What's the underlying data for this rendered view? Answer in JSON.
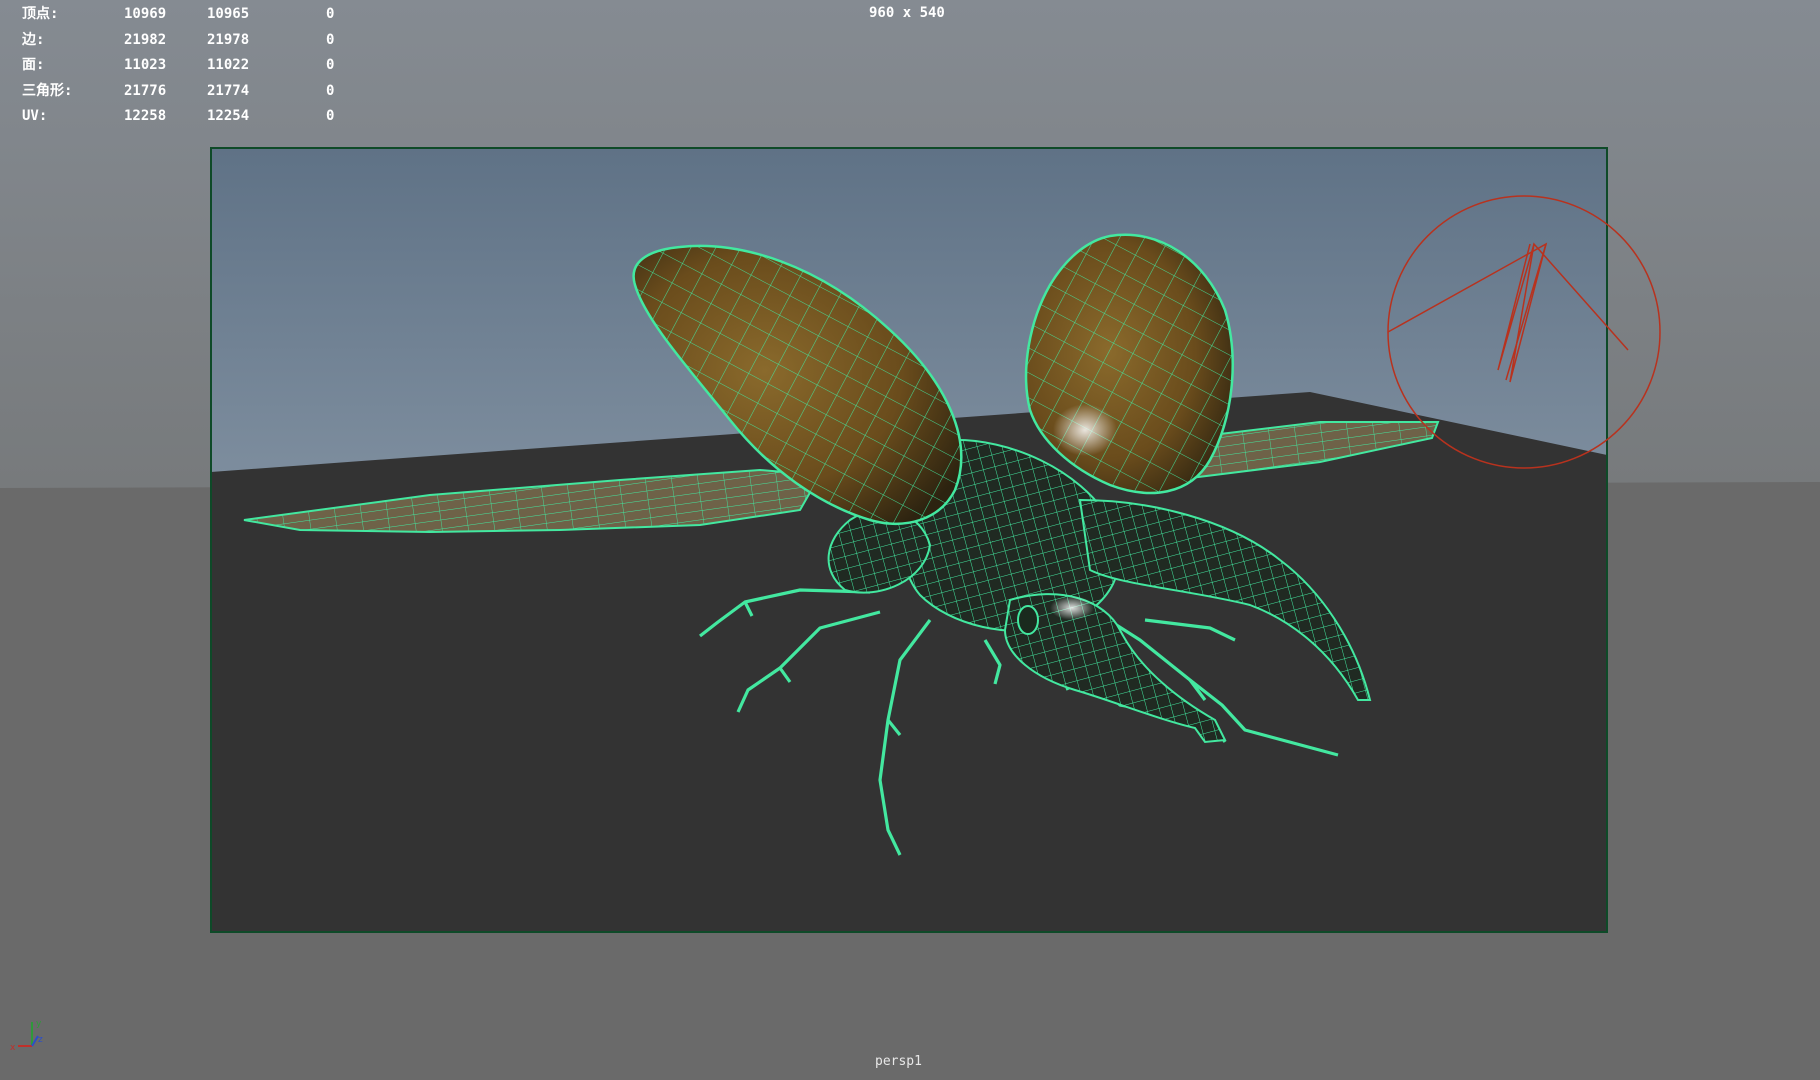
{
  "hud": {
    "rows": [
      {
        "label": "顶点:",
        "v1": "10969",
        "v2": "10965",
        "v3": "0"
      },
      {
        "label": "边:",
        "v1": "21982",
        "v2": "21978",
        "v3": "0"
      },
      {
        "label": "面:",
        "v1": "11023",
        "v2": "11022",
        "v3": "0"
      },
      {
        "label": "三角形:",
        "v1": "21776",
        "v2": "21774",
        "v3": "0"
      },
      {
        "label": "UV:",
        "v1": "12258",
        "v2": "12254",
        "v3": "0"
      }
    ]
  },
  "viewport": {
    "resolution": "960 x 540",
    "camera": "persp1"
  },
  "colors": {
    "wireframe": "#43e8a0",
    "gate": "#0e4a28",
    "shell": "#6a4c1c",
    "floor": "#333333",
    "camera_gizmo": "#b8321e"
  },
  "icons": {
    "axis_gizmo": "xyz-axis-icon",
    "camera_gizmo": "camera-manipulator-icon"
  }
}
